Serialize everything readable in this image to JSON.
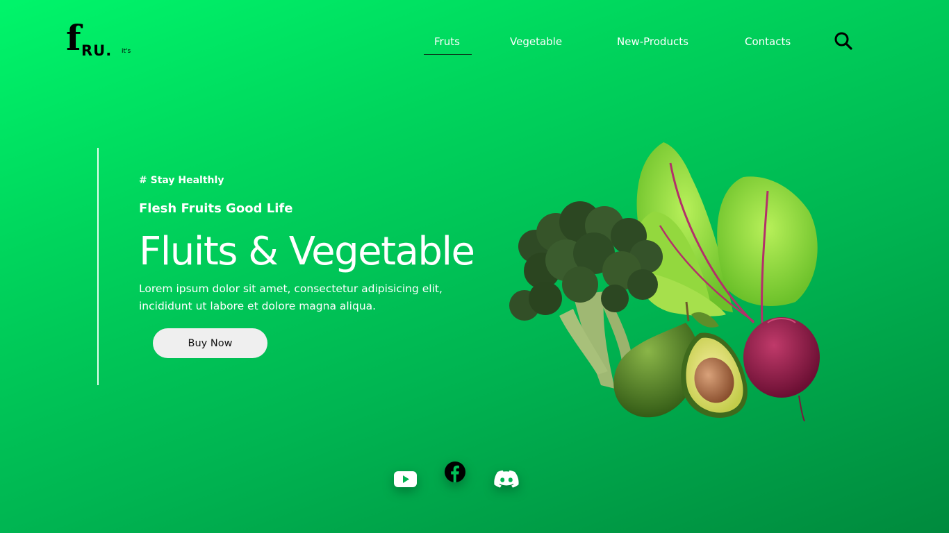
{
  "logo": {
    "mark": "f",
    "text": "RU.",
    "tagline": "it's"
  },
  "nav": {
    "items": [
      {
        "label": "Fruts",
        "active": true
      },
      {
        "label": "Vegetable",
        "active": false
      },
      {
        "label": "New-Products",
        "active": false
      },
      {
        "label": "Contacts",
        "active": false
      }
    ],
    "search_icon": "search-icon"
  },
  "hero": {
    "tag": "# Stay Healthly",
    "subtitle": "Flesh Fruits Good Life",
    "title": "Fluits & Vegetable",
    "description": "Lorem ipsum dolor sit amet, consectetur adipisicing elit, incididunt ut labore et dolore magna aliqua.",
    "cta_label": "Buy Now",
    "image_items": [
      "broccoli",
      "beet-greens",
      "avocado",
      "beetroot"
    ]
  },
  "socials": [
    {
      "name": "youtube",
      "icon": "youtube-icon"
    },
    {
      "name": "facebook",
      "icon": "facebook-icon"
    },
    {
      "name": "discord",
      "icon": "discord-icon"
    }
  ],
  "colors": {
    "background_start": "#00f56a",
    "background_end": "#008a3d",
    "text": "#ffffff",
    "button_bg": "#efefef",
    "dark": "#000000"
  }
}
